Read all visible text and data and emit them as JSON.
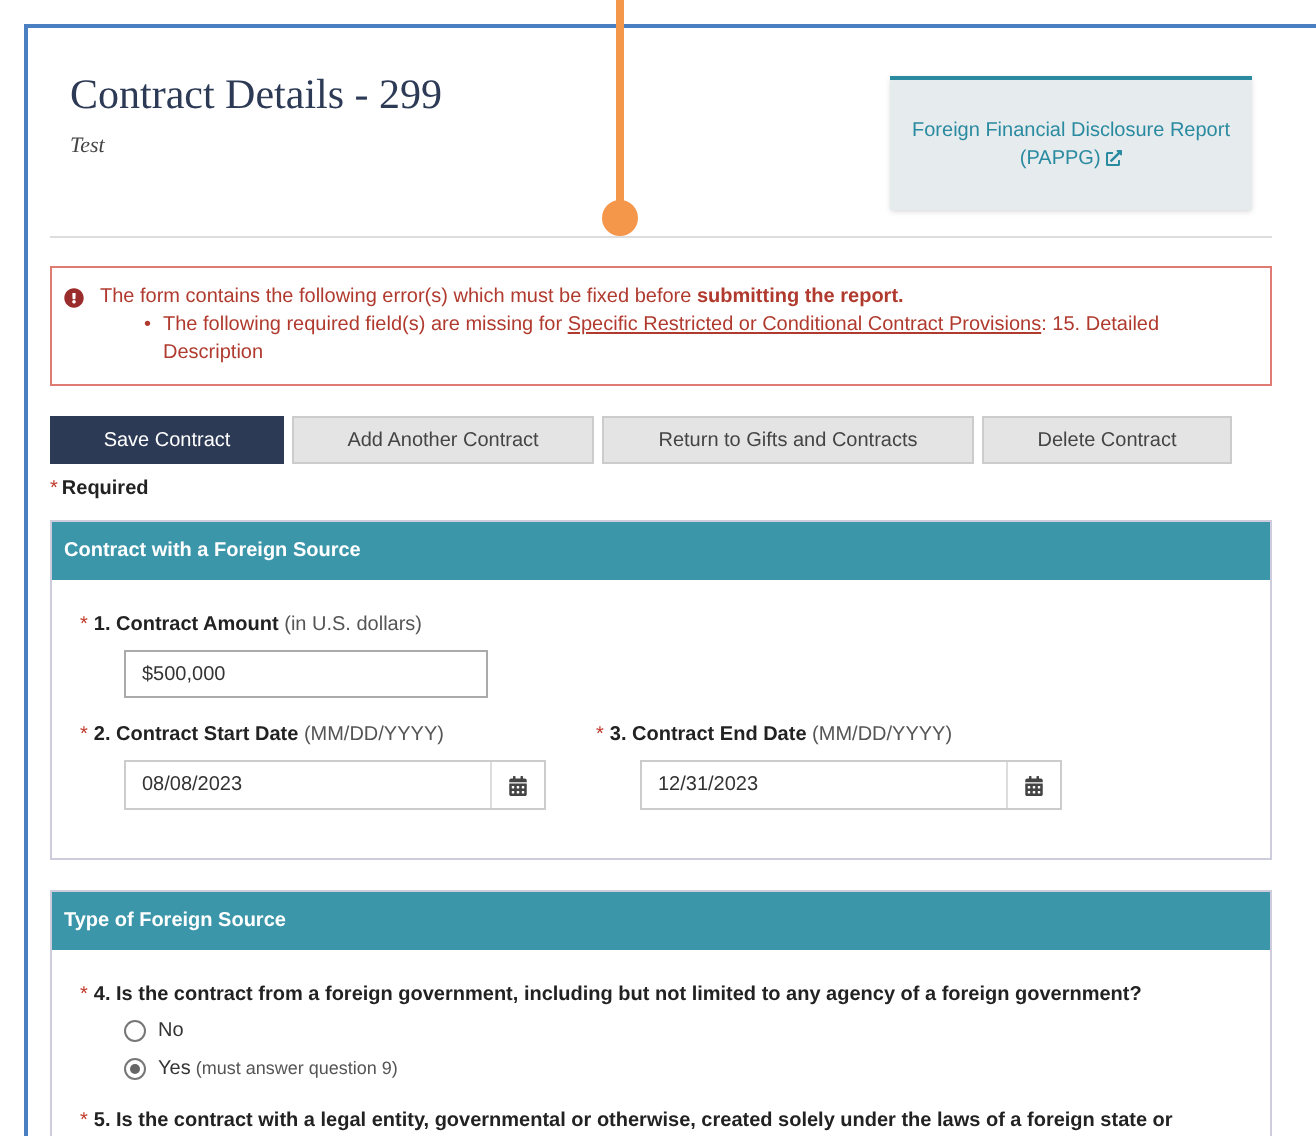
{
  "header": {
    "title": "Contract Details - 299",
    "subtitle": "Test",
    "report_link": "Foreign Financial Disclosure Report (PAPPG)"
  },
  "asterisk": "*",
  "error": {
    "message": "The form contains the following error(s) which must be fixed before **submitting the report.**",
    "bullet": "•",
    "items": [
      {
        "before": "The following required field(s) are missing for",
        "link": "Specific Restricted or Conditional Contract Provisions",
        "after": ": 15. Detailed Description"
      }
    ]
  },
  "buttons": [
    {
      "label": "Save Contract",
      "kind": "primary"
    },
    {
      "label": "Add Another Contract",
      "kind": "secondary"
    },
    {
      "label": "Return to Gifts and Contracts",
      "kind": "secondary"
    },
    {
      "label": "Delete Contract",
      "kind": "secondary"
    }
  ],
  "required_note": "Required",
  "sections": [
    {
      "title": "Contract with a Foreign Source",
      "rows": [
        [
          {
            "kind": "text",
            "required": true,
            "label": "1. Contract Amount",
            "hint": "(in U.S. dollars)",
            "value": "$500,000"
          }
        ],
        [
          {
            "kind": "date",
            "required": true,
            "label": "2. Contract Start Date",
            "hint": "(MM/DD/YYYY)",
            "value": "08/08/2023"
          },
          {
            "kind": "date",
            "required": true,
            "label": "3. Contract End Date",
            "hint": "(MM/DD/YYYY)",
            "value": "12/31/2023"
          }
        ]
      ]
    },
    {
      "title": "Type of Foreign Source",
      "rows": [
        [
          {
            "kind": "radio",
            "required": true,
            "label": "4. Is the contract from a foreign government, including but not limited to any agency of a foreign government?",
            "options": [
              {
                "label": "No",
                "selected": false
              },
              {
                "label": "Yes",
                "note": "(must answer question 9)",
                "selected": true
              }
            ]
          }
        ],
        [
          {
            "kind": "radio",
            "required": true,
            "label": "5. Is the contract with a legal entity, governmental or otherwise, created solely under the laws of a foreign state or"
          }
        ]
      ]
    }
  ]
}
